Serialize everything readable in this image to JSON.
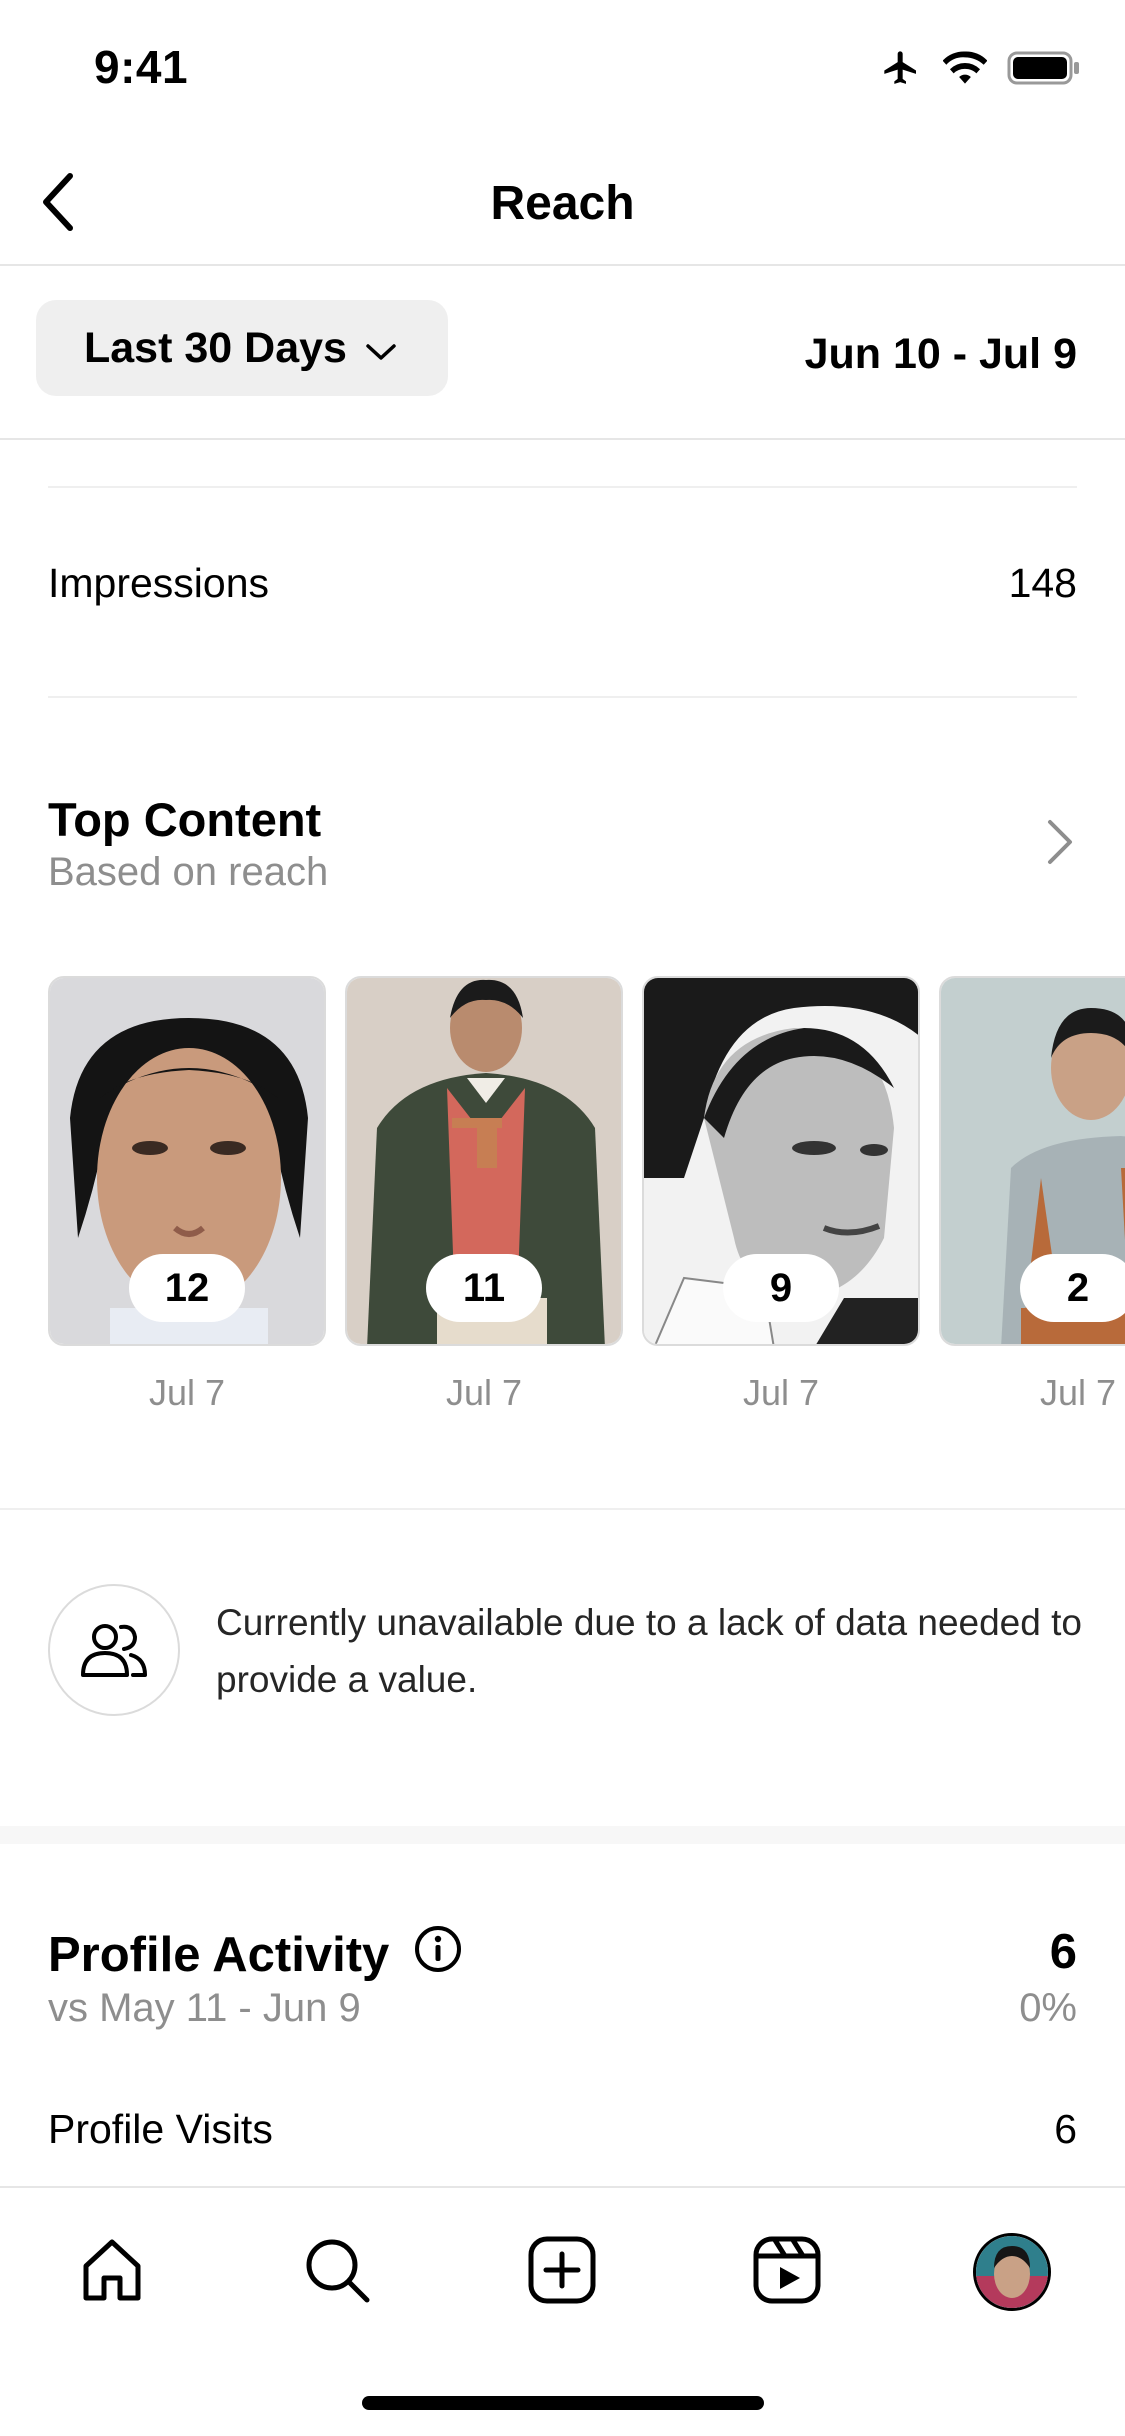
{
  "status_bar": {
    "time": "9:41",
    "icons": [
      "airplane-icon",
      "wifi-icon",
      "battery-icon"
    ]
  },
  "header": {
    "title": "Reach",
    "back_icon": "chevron-left-icon"
  },
  "filter": {
    "range_label": "Last 30 Days",
    "date_range": "Jun 10 - Jul 9"
  },
  "impressions": {
    "label": "Impressions",
    "value": "148"
  },
  "top_content": {
    "title": "Top Content",
    "subtitle": "Based on reach",
    "items": [
      {
        "count": "12",
        "date": "Jul 7"
      },
      {
        "count": "11",
        "date": "Jul 7"
      },
      {
        "count": "9",
        "date": "Jul 7"
      },
      {
        "count": "2",
        "date": "Jul 7"
      }
    ]
  },
  "notice": {
    "text": "Currently unavailable due to a lack of data needed to provide a value."
  },
  "profile_activity": {
    "title": "Profile Activity",
    "comparison": "vs May 11 - Jun 9",
    "value": "6",
    "change": "0%",
    "rows": [
      {
        "label": "Profile Visits",
        "value": "6"
      }
    ]
  },
  "tab_bar": {
    "items": [
      "home-icon",
      "search-icon",
      "create-icon",
      "reels-icon",
      "profile-avatar"
    ]
  },
  "colors": {
    "secondary_text": "#8e8e8e",
    "divider": "#efefef",
    "button_bg": "#efefef"
  }
}
